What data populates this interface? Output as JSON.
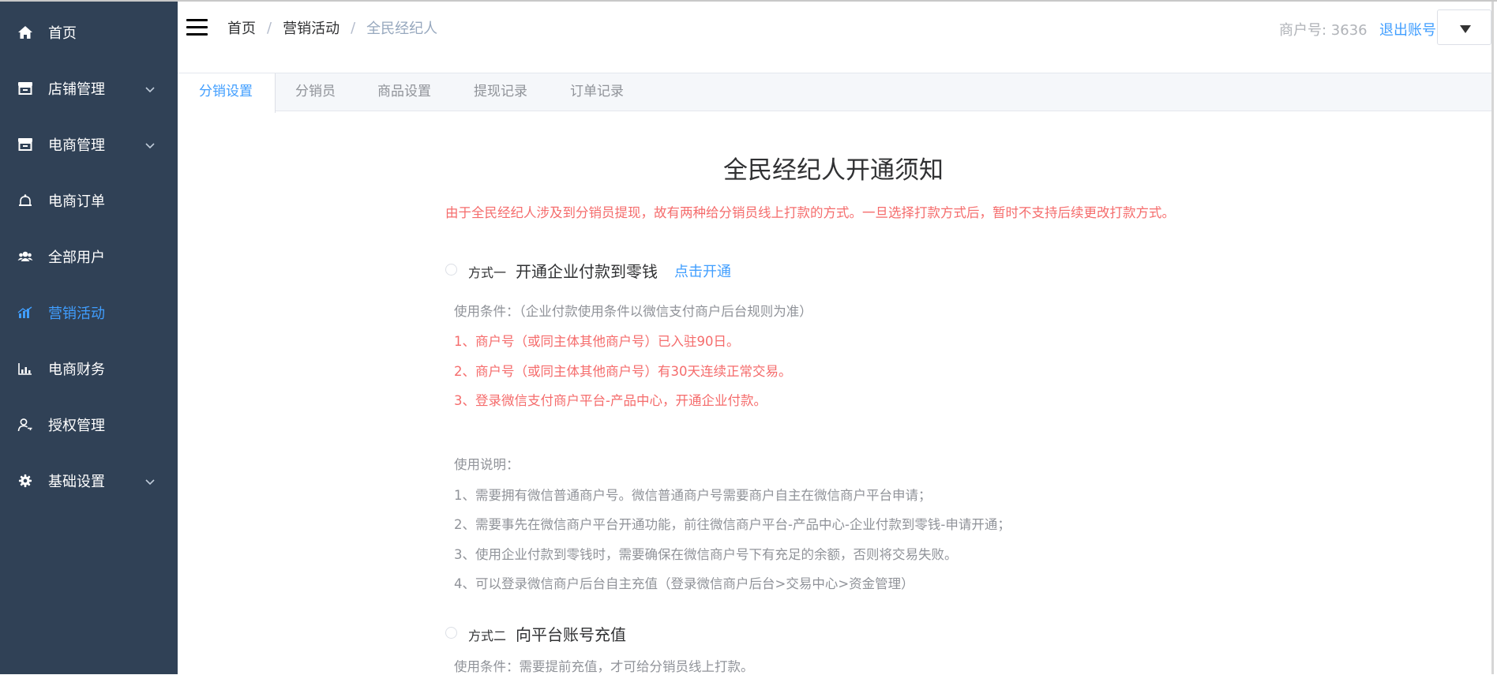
{
  "sidebar": {
    "items": [
      {
        "label": "首页",
        "icon": "home-icon"
      },
      {
        "label": "店铺管理",
        "icon": "store-icon",
        "has_children": true
      },
      {
        "label": "电商管理",
        "icon": "store-icon",
        "has_children": true
      },
      {
        "label": "电商订单",
        "icon": "bell-icon"
      },
      {
        "label": "全部用户",
        "icon": "users-icon"
      },
      {
        "label": "营销活动",
        "icon": "chart-icon",
        "active": true
      },
      {
        "label": "电商财务",
        "icon": "finance-icon"
      },
      {
        "label": "授权管理",
        "icon": "user-key-icon"
      },
      {
        "label": "基础设置",
        "icon": "gear-icon",
        "has_children": true
      }
    ]
  },
  "header": {
    "breadcrumb": [
      "首页",
      "营销活动",
      "全民经纪人"
    ],
    "breadcrumb_sep": "/",
    "merchant_label": "商户号: 3636",
    "logout_label": "退出账号"
  },
  "tabs": [
    "分销设置",
    "分销员",
    "商品设置",
    "提现记录",
    "订单记录"
  ],
  "content": {
    "title": "全民经纪人开通须知",
    "notice": "由于全民经纪人涉及到分销员提现，故有两种给分销员线上打款的方式。一旦选择打款方式后，暂时不支持后续更改打款方式。",
    "method1": {
      "prefix": "方式一",
      "name": "开通企业付款到零钱",
      "link": "点击开通",
      "conditions_label": "使用条件：（企业付款使用条件以微信支付商户后台规则为准）",
      "conditions": [
        "1、商户号（或同主体其他商户号）已入驻90日。",
        "2、商户号（或同主体其他商户号）有30天连续正常交易。",
        "3、登录微信支付商户平台-产品中心，开通企业付款。"
      ],
      "instructions_label": "使用说明：",
      "instructions": [
        "1、需要拥有微信普通商户号。微信普通商户号需要商户自主在微信商户平台申请；",
        "2、需要事先在微信商户平台开通功能，前往微信商户平台-产品中心-企业付款到零钱-申请开通；",
        "3、使用企业付款到零钱时，需要确保在微信商户号下有充足的余额，否则将交易失败。",
        "4、可以登录微信商户后台自主充值（登录微信商户后台>交易中心>资金管理）"
      ]
    },
    "method2": {
      "prefix": "方式二",
      "name": "向平台账号充值",
      "conditions_label": "使用条件：需要提前充值，才可给分销员线上打款。"
    }
  },
  "colors": {
    "sidebar_bg": "#304156",
    "accent": "#409eff",
    "danger": "#f56c6c"
  }
}
